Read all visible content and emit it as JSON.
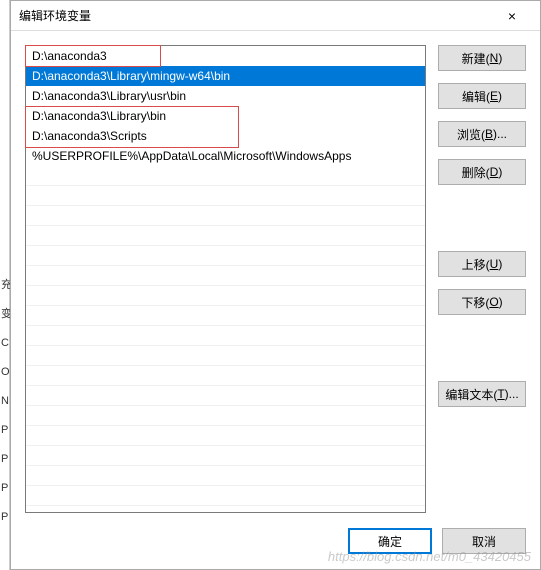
{
  "left_edge_chars": [
    "充",
    "变",
    "C",
    "O",
    "N",
    "P",
    "P",
    "P",
    "P"
  ],
  "dialog": {
    "title": "编辑环境变量",
    "close_label": "×"
  },
  "list": {
    "items": [
      {
        "text": "D:\\anaconda3",
        "selected": false
      },
      {
        "text": "D:\\anaconda3\\Library\\mingw-w64\\bin",
        "selected": true
      },
      {
        "text": "D:\\anaconda3\\Library\\usr\\bin",
        "selected": false
      },
      {
        "text": "D:\\anaconda3\\Library\\bin",
        "selected": false
      },
      {
        "text": "D:\\anaconda3\\Scripts",
        "selected": false
      },
      {
        "text": "%USERPROFILE%\\AppData\\Local\\Microsoft\\WindowsApps",
        "selected": false
      }
    ],
    "empty_rows": 17
  },
  "buttons": {
    "new": {
      "label": "新建(",
      "key": "N",
      "tail": ")"
    },
    "edit": {
      "label": "编辑(",
      "key": "E",
      "tail": ")"
    },
    "browse": {
      "label": "浏览(",
      "key": "B",
      "tail": ")..."
    },
    "delete": {
      "label": "删除(",
      "key": "D",
      "tail": ")"
    },
    "move_up": {
      "label": "上移(",
      "key": "U",
      "tail": ")"
    },
    "move_down": {
      "label": "下移(",
      "key": "O",
      "tail": ")"
    },
    "edit_text": {
      "label": "编辑文本(",
      "key": "T",
      "tail": ")..."
    },
    "ok": "确定",
    "cancel": "取消"
  },
  "watermark": "https://blog.csdn.net/m0_43420455"
}
